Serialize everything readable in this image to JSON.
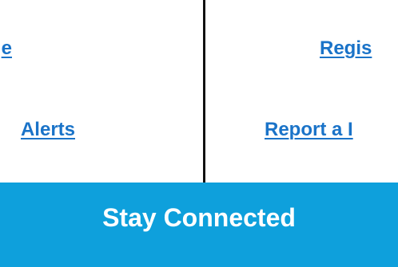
{
  "colors": {
    "link": "#1a73c8",
    "banner_background": "#0ea0dc",
    "banner_text": "#ffffff",
    "divider": "#111111"
  },
  "left_column": {
    "link_1": "e",
    "link_2": "Alerts"
  },
  "right_column": {
    "link_1": "Regis",
    "link_2": "Report a I"
  },
  "banner": {
    "title": "Stay Connected"
  }
}
